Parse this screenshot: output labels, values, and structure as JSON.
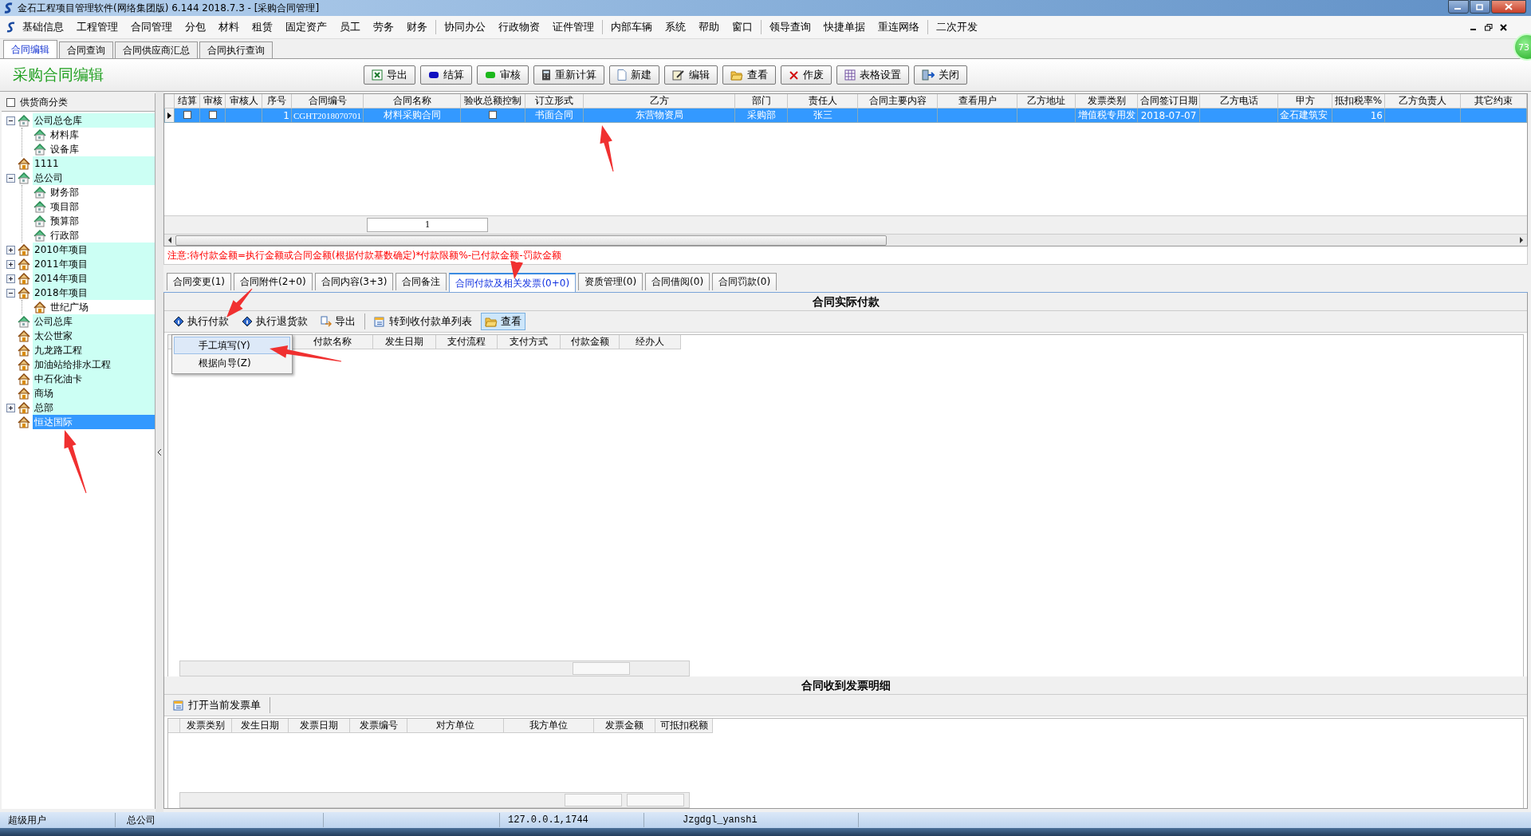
{
  "window": {
    "title": "金石工程项目管理软件(网络集团版) 6.144  2018.7.3 - [采购合同管理]"
  },
  "menu": [
    "基础信息",
    "工程管理",
    "合同管理",
    "分包",
    "材料",
    "租赁",
    "固定资产",
    "员工",
    "劳务",
    "财务",
    "协同办公",
    "行政物资",
    "证件管理",
    "内部车辆",
    "系统",
    "帮助",
    "窗口",
    "领导查询",
    "快捷单据",
    "重连网络",
    "二次开发"
  ],
  "float_badge": "73",
  "doc_tabs": [
    {
      "label": "合同编辑",
      "selected": true
    },
    {
      "label": "合同查询",
      "selected": false
    },
    {
      "label": "合同供应商汇总",
      "selected": false
    },
    {
      "label": "合同执行查询",
      "selected": false
    }
  ],
  "page_title": "采购合同编辑",
  "toolbar": [
    "导出",
    "结算",
    "审核",
    "重新计算",
    "新建",
    "编辑",
    "查看",
    "作废",
    "表格设置",
    "关闭"
  ],
  "supplier_tree": {
    "label": "供货商分类",
    "checked": false,
    "items": [
      {
        "label": "公司总仓库",
        "kind": "warehouse",
        "expanded": true,
        "selected": false,
        "children": [
          {
            "label": "材料库",
            "kind": "warehouse",
            "selected": false
          },
          {
            "label": "设备库",
            "kind": "warehouse",
            "selected": false
          }
        ]
      },
      {
        "label": "1111",
        "kind": "house",
        "selected": false
      },
      {
        "label": "总公司",
        "kind": "warehouse",
        "expanded": true,
        "selected": false,
        "children": [
          {
            "label": "财务部",
            "kind": "warehouse",
            "selected": false
          },
          {
            "label": "项目部",
            "kind": "warehouse",
            "selected": false
          },
          {
            "label": "预算部",
            "kind": "warehouse",
            "selected": false
          },
          {
            "label": "行政部",
            "kind": "warehouse",
            "selected": false
          }
        ]
      },
      {
        "label": "2010年项目",
        "kind": "house",
        "expanded": false,
        "selected": false
      },
      {
        "label": "2011年项目",
        "kind": "house",
        "expanded": false,
        "selected": false
      },
      {
        "label": "2014年项目",
        "kind": "house",
        "expanded": false,
        "selected": false
      },
      {
        "label": "2018年项目",
        "kind": "house",
        "expanded": true,
        "selected": false,
        "children": [
          {
            "label": "世纪广场",
            "kind": "house",
            "selected": false
          }
        ]
      },
      {
        "label": "公司总库",
        "kind": "warehouse",
        "selected": false
      },
      {
        "label": "太公世家",
        "kind": "house",
        "selected": false
      },
      {
        "label": "九龙路工程",
        "kind": "house",
        "selected": false
      },
      {
        "label": "加油站给排水工程",
        "kind": "house",
        "selected": false
      },
      {
        "label": "中石化油卡",
        "kind": "house",
        "selected": false
      },
      {
        "label": "商场",
        "kind": "house",
        "selected": false
      },
      {
        "label": "总部",
        "kind": "house",
        "expanded": false,
        "selected": false
      },
      {
        "label": "恒达国际",
        "kind": "house",
        "selected": true
      }
    ]
  },
  "contracts": {
    "columns": [
      "结算",
      "审核",
      "审核人",
      "序号",
      "合同编号",
      "合同名称",
      "验收总额控制",
      "订立形式",
      "乙方",
      "部门",
      "责任人",
      "合同主要内容",
      "查看用户",
      "乙方地址",
      "发票类别",
      "合同签订日期",
      "乙方电话",
      "甲方",
      "抵扣税率%",
      "乙方负责人",
      "其它约束"
    ],
    "rows": [
      {
        "selected": true,
        "cells": [
          {
            "kind": "check",
            "checked": false
          },
          {
            "kind": "check",
            "checked": false
          },
          {
            "kind": "empty"
          },
          {
            "kind": "num",
            "text": "1"
          },
          {
            "kind": "code",
            "text": "CGHT2018070701"
          },
          {
            "kind": "text",
            "text": "材料采购合同"
          },
          {
            "kind": "check",
            "checked": false
          },
          {
            "kind": "text",
            "text": "书面合同"
          },
          {
            "kind": "text",
            "text": "东营物资局"
          },
          {
            "kind": "text",
            "text": "采购部"
          },
          {
            "kind": "text",
            "text": "张三"
          },
          {
            "kind": "empty"
          },
          {
            "kind": "empty"
          },
          {
            "kind": "empty"
          },
          {
            "kind": "text",
            "text": "增值税专用发"
          },
          {
            "kind": "text",
            "text": "2018-07-07"
          },
          {
            "kind": "empty"
          },
          {
            "kind": "left",
            "text": "金石建筑安"
          },
          {
            "kind": "num",
            "text": "16"
          },
          {
            "kind": "empty"
          },
          {
            "kind": "empty"
          }
        ]
      }
    ],
    "footer_count": "1"
  },
  "note": "注意:待付款金额=执行金额或合同金额(根据付款基数确定)*付款限额%-已付款金额-罚款金额",
  "detail_tabs": [
    {
      "label": "合同变更(1)",
      "selected": false
    },
    {
      "label": "合同附件(2+0)",
      "selected": false
    },
    {
      "label": "合同内容(3+3)",
      "selected": false
    },
    {
      "label": "合同备注",
      "selected": false
    },
    {
      "label": "合同付款及相关发票(0+0)",
      "selected": true
    },
    {
      "label": "资质管理(0)",
      "selected": false
    },
    {
      "label": "合同借阅(0)",
      "selected": false
    },
    {
      "label": "合同罚款(0)",
      "selected": false
    }
  ],
  "payments": {
    "title": "合同实际付款",
    "toolbar": [
      {
        "label": "执行付款",
        "pressed": false
      },
      {
        "label": "执行退货款",
        "pressed": false
      },
      {
        "label": "导出",
        "pressed": false
      },
      {
        "label": "转到收付款单列表",
        "pressed": false
      },
      {
        "label": "查看",
        "pressed": true
      }
    ],
    "menu": [
      {
        "label": "手工填写(Y)",
        "selected": true
      },
      {
        "label": "根据向导(Z)",
        "selected": false
      }
    ],
    "columns": [
      "付款名称",
      "发生日期",
      "支付流程",
      "支付方式",
      "付款金额",
      "经办人"
    ]
  },
  "invoices": {
    "title": "合同收到发票明细",
    "toolbar": [
      "打开当前发票单"
    ],
    "columns": [
      "发票类别",
      "发生日期",
      "发票日期",
      "发票编号",
      "对方单位",
      "我方单位",
      "发票金额",
      "可抵扣税额"
    ]
  },
  "status_bar": [
    "超级用户",
    "总公司",
    "127.0.0.1,1744",
    "Jzgdgl_yanshi"
  ]
}
